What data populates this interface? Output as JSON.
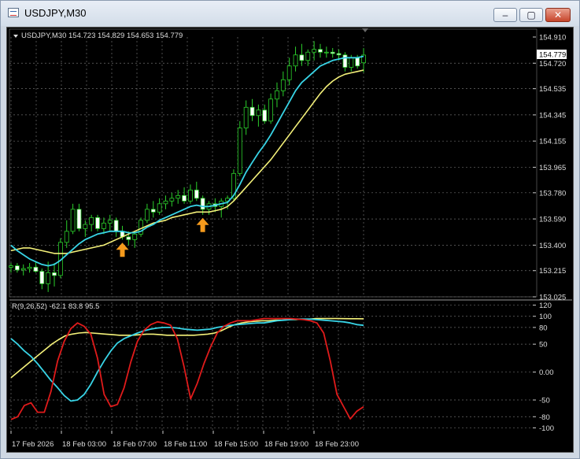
{
  "window": {
    "title": "USDJPY,M30",
    "minimize_label": "–",
    "maximize_label": "▢",
    "close_label": "✕"
  },
  "main_panel": {
    "info": "USDJPY,M30  154.723 154.829 154.653 154.779",
    "price_axis": [
      "154.910",
      "154.720",
      "154.535",
      "154.345",
      "154.155",
      "153.965",
      "153.780",
      "153.590",
      "153.400",
      "153.215",
      "153.025"
    ],
    "current_price": "154.779"
  },
  "indicator_panel": {
    "info": "R(9,26,52) -62.1 83.8 95.5",
    "axis": [
      "120",
      "100",
      "80",
      "50",
      "0.00",
      "-50",
      "-80",
      "-100"
    ]
  },
  "time_axis": [
    "17 Feb 2026",
    "18 Feb 03:00",
    "18 Feb 07:00",
    "18 Feb 11:00",
    "18 Feb 15:00",
    "18 Feb 19:00",
    "18 Feb 23:00"
  ],
  "colors": {
    "candle": "#2bd02b",
    "fast_ma": "#38d4e6",
    "slow_ma": "#f5f27a",
    "r_fast": "#e01b1b",
    "r_mid": "#38d4e6",
    "r_slow": "#f5f27a",
    "arrow": "#f59a1c"
  },
  "chart_data": {
    "type": "candlestick",
    "symbol": "USDJPY",
    "timeframe": "M30",
    "ylim": [
      153.025,
      154.91
    ],
    "candles_ohlc": [
      [
        153.24,
        153.27,
        153.2,
        153.25
      ],
      [
        153.25,
        153.27,
        153.2,
        153.22
      ],
      [
        153.22,
        153.26,
        153.18,
        153.23
      ],
      [
        153.23,
        153.27,
        153.2,
        153.24
      ],
      [
        153.24,
        153.28,
        153.2,
        153.21
      ],
      [
        153.21,
        153.23,
        153.08,
        153.12
      ],
      [
        153.12,
        153.28,
        153.06,
        153.2
      ],
      [
        153.2,
        153.27,
        153.1,
        153.18
      ],
      [
        153.18,
        153.45,
        153.16,
        153.42
      ],
      [
        153.42,
        153.58,
        153.38,
        153.5
      ],
      [
        153.5,
        153.7,
        153.48,
        153.66
      ],
      [
        153.66,
        153.7,
        153.5,
        153.52
      ],
      [
        153.52,
        153.58,
        153.46,
        153.55
      ],
      [
        153.55,
        153.62,
        153.5,
        153.6
      ],
      [
        153.6,
        153.62,
        153.5,
        153.52
      ],
      [
        153.52,
        153.6,
        153.48,
        153.56
      ],
      [
        153.56,
        153.62,
        153.5,
        153.58
      ],
      [
        153.58,
        153.6,
        153.46,
        153.5
      ],
      [
        153.5,
        153.54,
        153.44,
        153.46
      ],
      [
        153.46,
        153.5,
        153.4,
        153.44
      ],
      [
        153.44,
        153.5,
        153.38,
        153.48
      ],
      [
        153.48,
        153.6,
        153.46,
        153.58
      ],
      [
        153.58,
        153.7,
        153.56,
        153.66
      ],
      [
        153.66,
        153.72,
        153.6,
        153.64
      ],
      [
        153.64,
        153.74,
        153.62,
        153.7
      ],
      [
        153.7,
        153.76,
        153.66,
        153.72
      ],
      [
        153.72,
        153.78,
        153.68,
        153.74
      ],
      [
        153.74,
        153.8,
        153.7,
        153.76
      ],
      [
        153.76,
        153.82,
        153.7,
        153.72
      ],
      [
        153.72,
        153.84,
        153.7,
        153.8
      ],
      [
        153.8,
        153.86,
        153.72,
        153.74
      ],
      [
        153.74,
        153.76,
        153.62,
        153.66
      ],
      [
        153.66,
        153.72,
        153.62,
        153.7
      ],
      [
        153.7,
        153.74,
        153.64,
        153.68
      ],
      [
        153.68,
        153.74,
        153.6,
        153.72
      ],
      [
        153.72,
        153.76,
        153.66,
        153.74
      ],
      [
        153.74,
        153.95,
        153.72,
        153.92
      ],
      [
        153.92,
        154.3,
        153.9,
        154.25
      ],
      [
        154.25,
        154.45,
        154.2,
        154.4
      ],
      [
        154.4,
        154.46,
        154.3,
        154.34
      ],
      [
        154.34,
        154.42,
        154.26,
        154.38
      ],
      [
        154.38,
        154.42,
        154.28,
        154.3
      ],
      [
        154.3,
        154.5,
        154.28,
        154.46
      ],
      [
        154.46,
        154.58,
        154.4,
        154.52
      ],
      [
        154.52,
        154.66,
        154.48,
        154.6
      ],
      [
        154.6,
        154.76,
        154.56,
        154.7
      ],
      [
        154.7,
        154.84,
        154.66,
        154.78
      ],
      [
        154.78,
        154.86,
        154.7,
        154.74
      ],
      [
        154.74,
        154.82,
        154.7,
        154.8
      ],
      [
        154.8,
        154.88,
        154.74,
        154.82
      ],
      [
        154.82,
        154.86,
        154.76,
        154.8
      ],
      [
        154.8,
        154.84,
        154.76,
        154.8
      ],
      [
        154.8,
        154.83,
        154.76,
        154.79
      ],
      [
        154.79,
        154.82,
        154.74,
        154.78
      ],
      [
        154.78,
        154.8,
        154.66,
        154.69
      ],
      [
        154.69,
        154.78,
        154.66,
        154.76
      ],
      [
        154.76,
        154.78,
        154.68,
        154.7
      ],
      [
        154.723,
        154.829,
        154.653,
        154.779
      ]
    ],
    "fast_ma": [
      153.4,
      153.36,
      153.33,
      153.3,
      153.28,
      153.26,
      153.25,
      153.26,
      153.29,
      153.33,
      153.37,
      153.41,
      153.44,
      153.46,
      153.48,
      153.49,
      153.5,
      153.5,
      153.5,
      153.49,
      153.49,
      153.5,
      153.53,
      153.55,
      153.58,
      153.6,
      153.62,
      153.64,
      153.66,
      153.68,
      153.69,
      153.68,
      153.68,
      153.69,
      153.7,
      153.71,
      153.76,
      153.84,
      153.93,
      154.0,
      154.07,
      154.13,
      154.2,
      154.28,
      154.36,
      154.44,
      154.52,
      154.58,
      154.62,
      154.66,
      154.7,
      154.72,
      154.74,
      154.75,
      154.76,
      154.76,
      154.76,
      154.77
    ],
    "slow_ma": [
      153.36,
      153.37,
      153.38,
      153.38,
      153.37,
      153.36,
      153.35,
      153.34,
      153.34,
      153.34,
      153.35,
      153.36,
      153.37,
      153.38,
      153.39,
      153.4,
      153.42,
      153.44,
      153.46,
      153.48,
      153.5,
      153.52,
      153.54,
      153.56,
      153.57,
      153.58,
      153.6,
      153.61,
      153.62,
      153.63,
      153.64,
      153.64,
      153.64,
      153.65,
      153.66,
      153.68,
      153.72,
      153.77,
      153.82,
      153.87,
      153.92,
      153.97,
      154.02,
      154.08,
      154.14,
      154.2,
      154.26,
      154.32,
      154.38,
      154.44,
      154.5,
      154.55,
      154.59,
      154.62,
      154.64,
      154.65,
      154.66,
      154.67
    ],
    "buy_arrows_candle_index": [
      18,
      31
    ],
    "indicator": {
      "name": "R(9,26,52)",
      "ylim": [
        -105,
        125
      ],
      "last_values": [
        -62.1,
        83.8,
        95.5
      ],
      "red": [
        -85,
        -80,
        -60,
        -55,
        -72,
        -72,
        -35,
        20,
        55,
        78,
        88,
        82,
        68,
        25,
        -40,
        -62,
        -58,
        -28,
        18,
        55,
        75,
        85,
        90,
        88,
        84,
        60,
        10,
        -48,
        -20,
        15,
        45,
        70,
        82,
        88,
        92,
        92,
        92,
        94,
        96,
        96,
        96,
        96,
        96,
        95,
        94,
        92,
        88,
        70,
        20,
        -40,
        -62,
        -84,
        -70,
        -62.1
      ],
      "cyan": [
        60,
        50,
        38,
        28,
        15,
        0,
        -15,
        -28,
        -42,
        -52,
        -50,
        -40,
        -22,
        0,
        20,
        38,
        52,
        60,
        65,
        70,
        74,
        77,
        79,
        80,
        80,
        79,
        77,
        76,
        75,
        76,
        77,
        80,
        82,
        84,
        85,
        86,
        87,
        88,
        88,
        90,
        92,
        93,
        94,
        95,
        95,
        95,
        94,
        93,
        92,
        91,
        90,
        88,
        85,
        83.8
      ],
      "yellow": [
        -10,
        0,
        10,
        20,
        30,
        40,
        50,
        58,
        65,
        68,
        70,
        71,
        70,
        69,
        68,
        67,
        66,
        66,
        66,
        67,
        68,
        68,
        67,
        66,
        66,
        66,
        66,
        66,
        67,
        68,
        70,
        74,
        80,
        85,
        88,
        90,
        91,
        92,
        92,
        93,
        93,
        94,
        94,
        95,
        95,
        96,
        96,
        96,
        96,
        95.8,
        95.7,
        95.6,
        95.5
      ]
    }
  }
}
